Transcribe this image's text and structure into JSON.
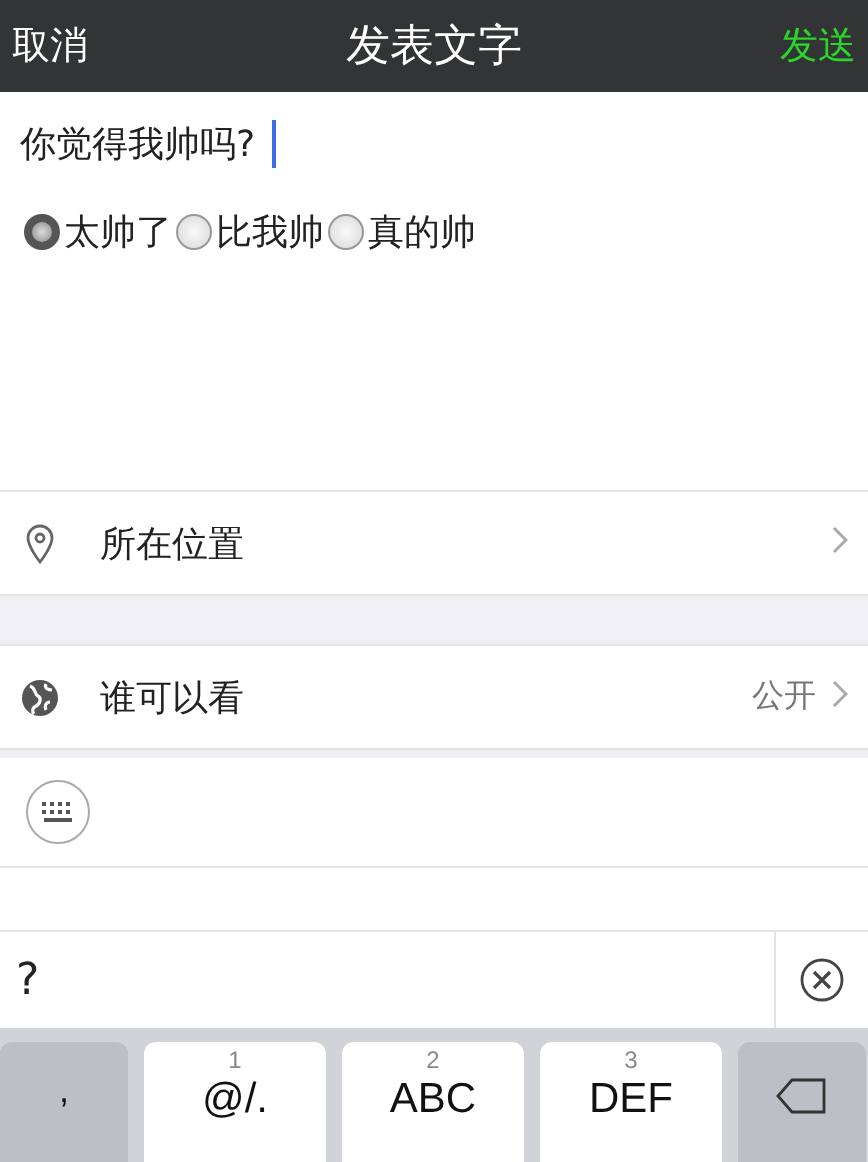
{
  "header": {
    "cancel": "取消",
    "title": "发表文字",
    "send": "发送"
  },
  "compose": {
    "value": "你觉得我帅吗?",
    "options": [
      {
        "label": "太帅了",
        "selected": true
      },
      {
        "label": "比我帅",
        "selected": false
      },
      {
        "label": "真的帅",
        "selected": false
      }
    ]
  },
  "rows": [
    {
      "kind": "location",
      "label": "所在位置"
    },
    {
      "kind": "visibility",
      "label": "谁可以看",
      "value": "公开"
    }
  ],
  "candidate": {
    "text": "?"
  },
  "keys": [
    {
      "kind": "symbol",
      "label": ","
    },
    {
      "kind": "letter",
      "number": "1",
      "label": "@/."
    },
    {
      "kind": "letter",
      "number": "2",
      "label": "ABC"
    },
    {
      "kind": "letter",
      "number": "3",
      "label": "DEF"
    },
    {
      "kind": "delete"
    }
  ]
}
